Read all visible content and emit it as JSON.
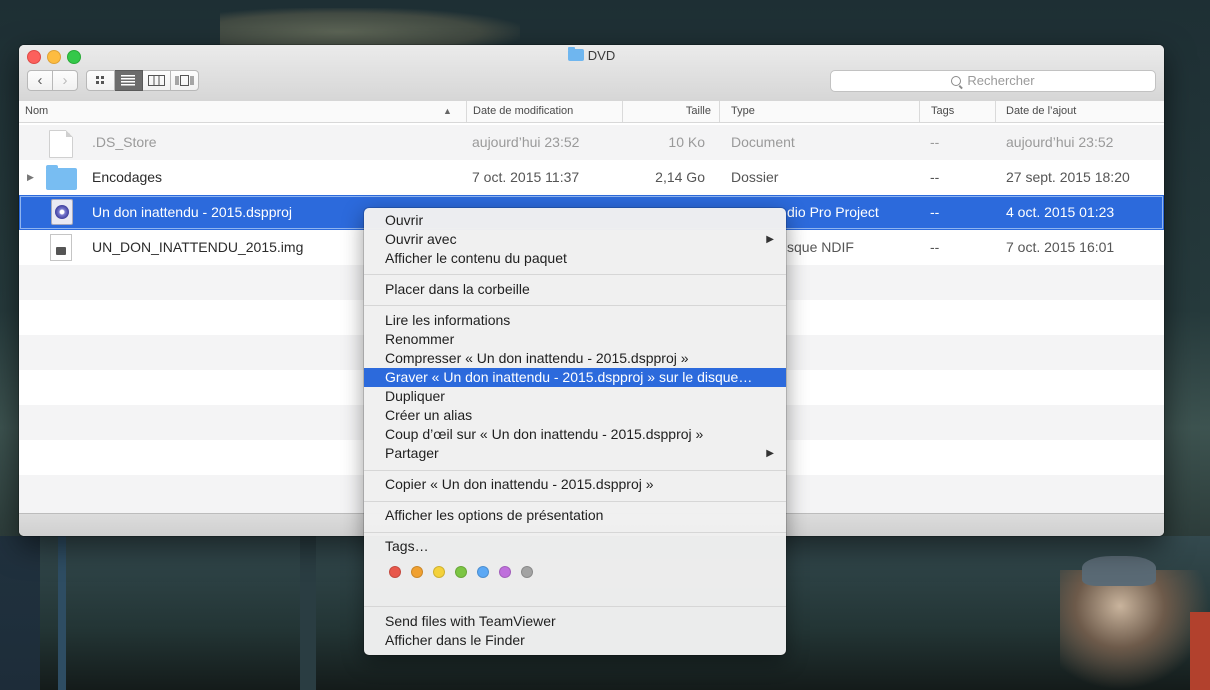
{
  "window": {
    "title": "DVD"
  },
  "toolbar": {
    "back_glyph": "‹",
    "forward_glyph": "›",
    "search_placeholder": "Rechercher"
  },
  "columns": {
    "name": "Nom",
    "modified": "Date de modification",
    "size": "Taille",
    "type": "Type",
    "tags": "Tags",
    "added": "Date de l’ajout"
  },
  "files": [
    {
      "name": ".DS_Store",
      "modified": "aujourd’hui 23:52",
      "size": "10 Ko",
      "type": "Document",
      "tags": "--",
      "added": "aujourd’hui 23:52",
      "icon": "document-icon"
    },
    {
      "name": "Encodages",
      "modified": "7 oct. 2015 11:37",
      "size": "2,14 Go",
      "type": "Dossier",
      "tags": "--",
      "added": "27 sept. 2015 18:20",
      "icon": "folder-icon"
    },
    {
      "name": "Un don inattendu - 2015.dspproj",
      "modified": "",
      "size": "",
      "type": "dio Pro Project",
      "tags": "--",
      "added": "4 oct. 2015 01:23",
      "icon": "dvd-studio-project-icon"
    },
    {
      "name": "UN_DON_INATTENDU_2015.img",
      "modified": "",
      "size": "",
      "type": "sque NDIF",
      "tags": "--",
      "added": "7 oct. 2015 16:01",
      "icon": "disk-image-icon"
    }
  ],
  "context_menu": {
    "group1": [
      "Ouvrir",
      "Ouvrir avec",
      "Afficher le contenu du paquet"
    ],
    "group2": [
      "Placer dans la corbeille"
    ],
    "group3": [
      "Lire les informations",
      "Renommer",
      "Compresser « Un don inattendu - 2015.dspproj »",
      "Graver « Un don inattendu - 2015.dspproj » sur le disque…",
      "Dupliquer",
      "Créer un alias",
      "Coup d’œil sur « Un don inattendu - 2015.dspproj »",
      "Partager"
    ],
    "group4": [
      "Copier « Un don inattendu - 2015.dspproj »"
    ],
    "group5": [
      "Afficher les options de présentation"
    ],
    "tags_label": "Tags…",
    "tag_colors": [
      "#e8574b",
      "#f0a030",
      "#f4d13a",
      "#7cc543",
      "#5ba8f5",
      "#bf6fdc",
      "#a3a3a3"
    ],
    "group6": [
      "Send files with TeamViewer",
      "Afficher dans le Finder"
    ],
    "submenu_glyph": "▶"
  },
  "accent": "#2c6adc"
}
